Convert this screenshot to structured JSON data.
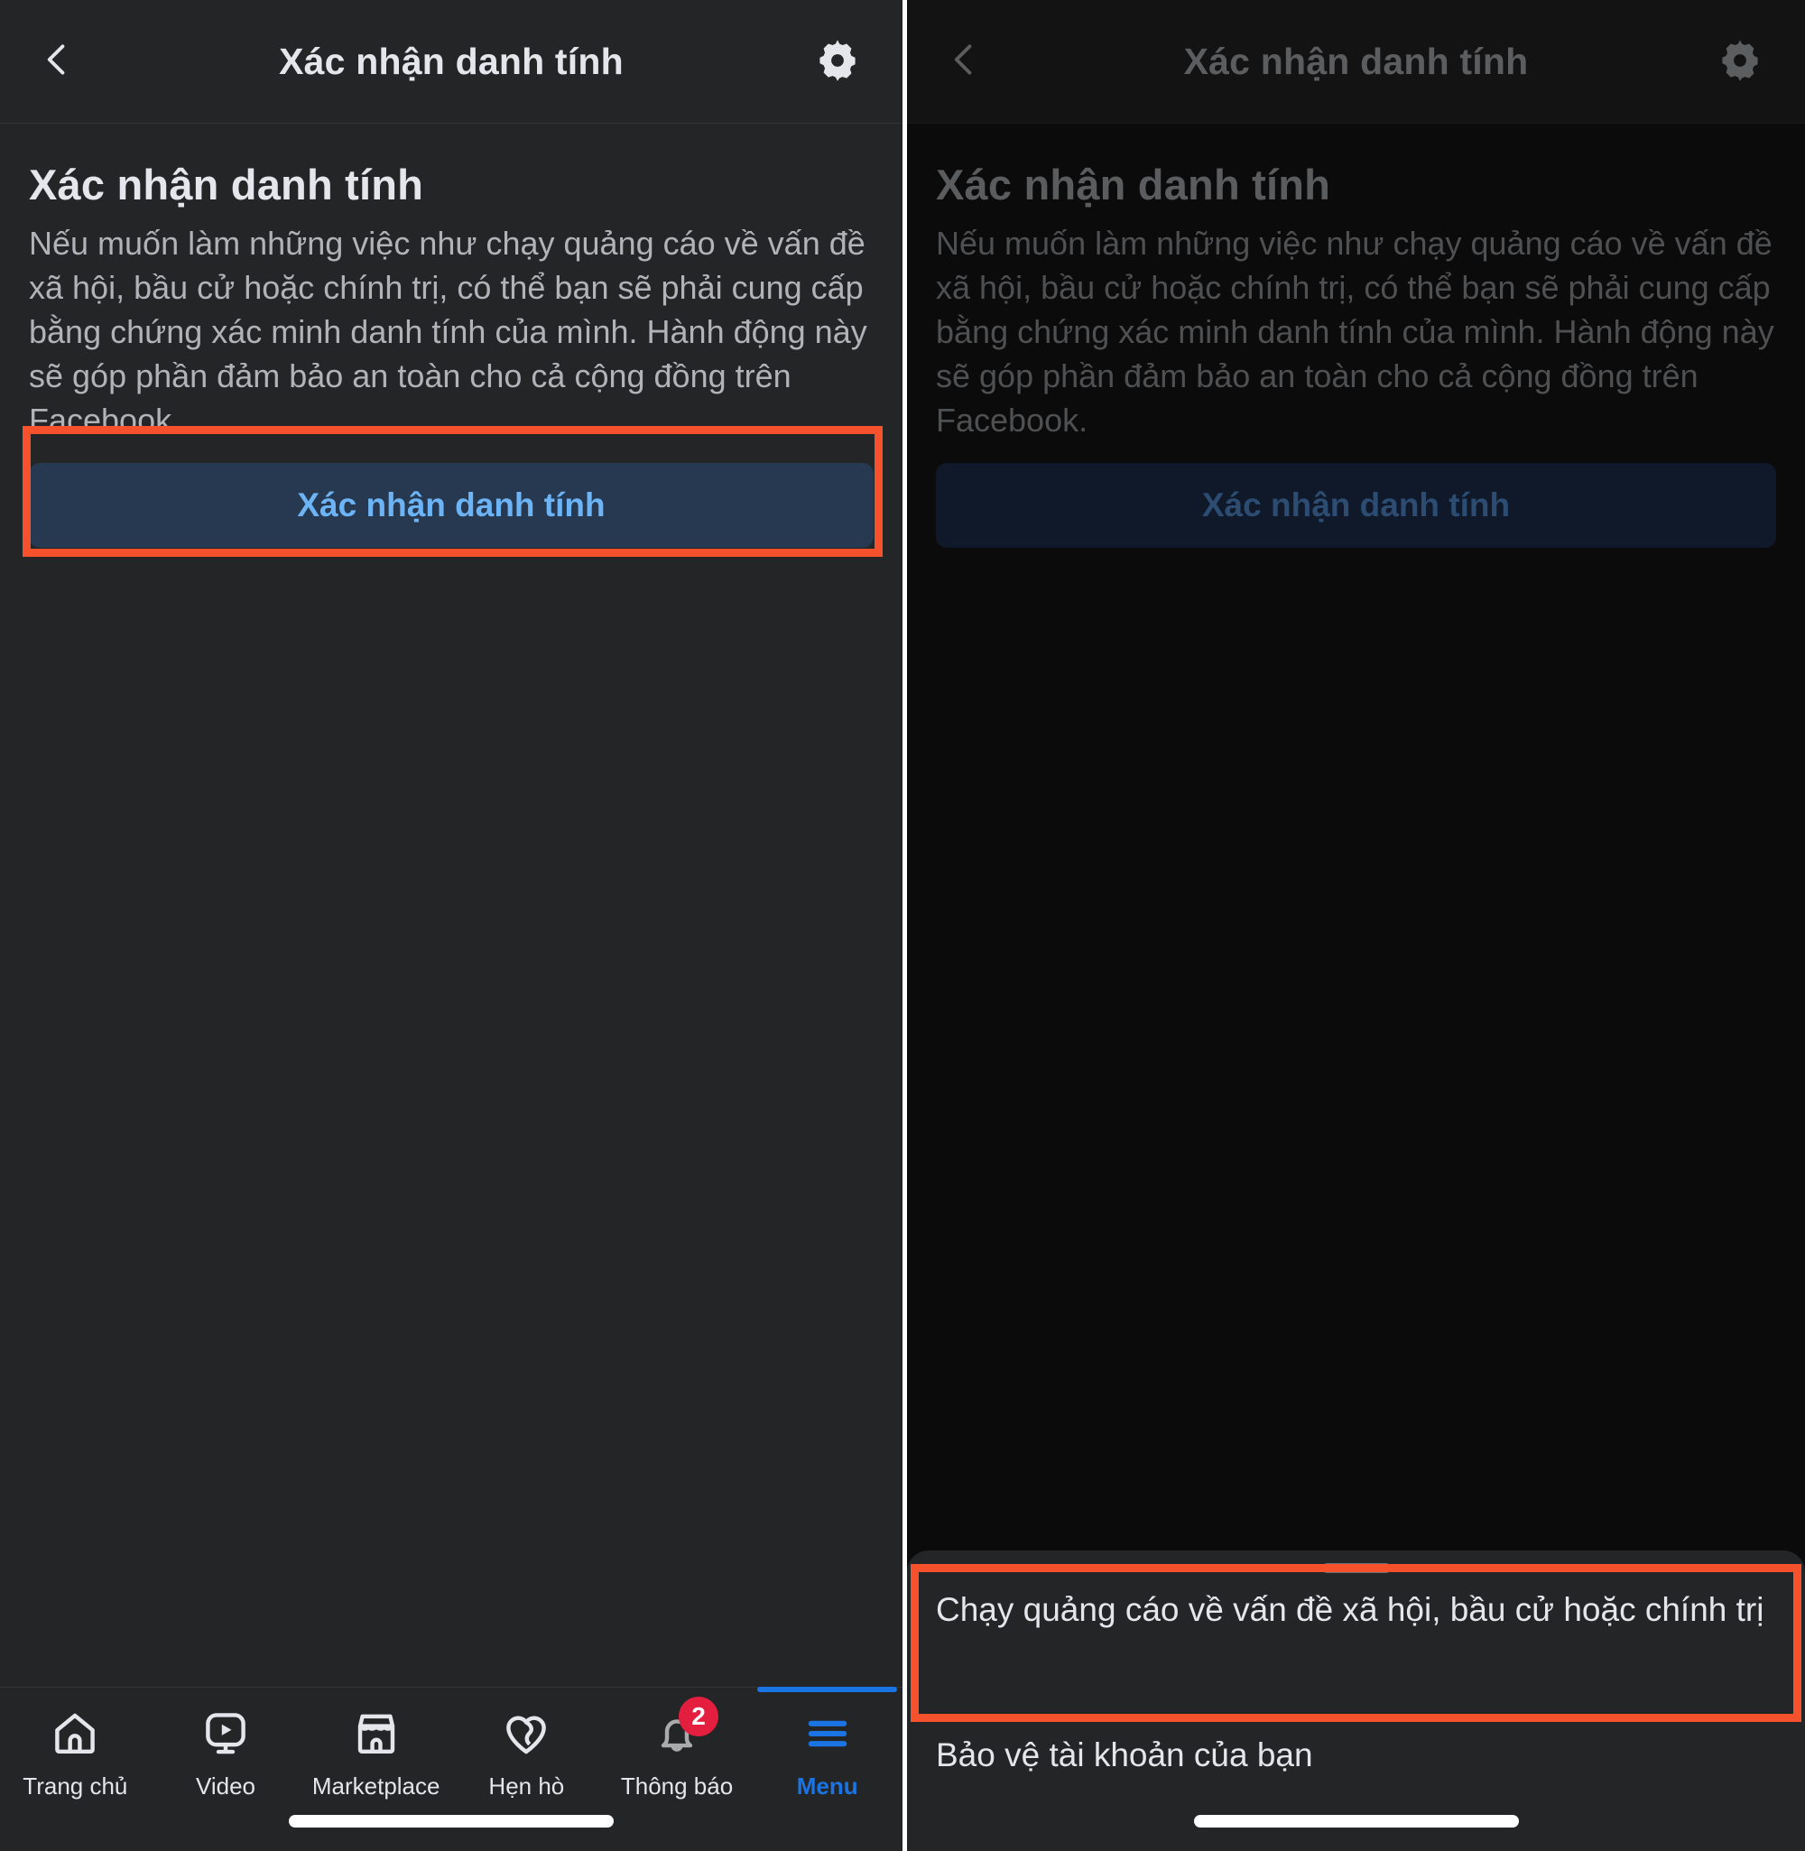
{
  "colors": {
    "highlight": "#f4512c",
    "accent_blue": "#1b74e4",
    "cta_text": "#6cb4f5",
    "cta_bg": "#263951",
    "badge_red": "#e41e3f",
    "panel_bg": "#242526",
    "dim_panel_bg": "#0b0b0c"
  },
  "header": {
    "title": "Xác nhận danh tính",
    "back_icon": "chevron-left-icon",
    "settings_icon": "gear-icon"
  },
  "main": {
    "title": "Xác nhận danh tính",
    "description": "Nếu muốn làm những việc như chạy quảng cáo về vấn đề xã hội, bầu cử hoặc chính trị, có thể bạn sẽ phải cung cấp bằng chứng xác minh danh tính của mình. Hành động này sẽ góp phần đảm bảo an toàn cho cả cộng đồng trên Facebook.",
    "cta_label": "Xác nhận danh tính"
  },
  "tabbar": {
    "items": [
      {
        "label": "Trang chủ",
        "icon": "home-icon",
        "active": false,
        "badge": ""
      },
      {
        "label": "Video",
        "icon": "video-icon",
        "active": false,
        "badge": ""
      },
      {
        "label": "Marketplace",
        "icon": "marketplace-icon",
        "active": false,
        "badge": ""
      },
      {
        "label": "Hẹn hò",
        "icon": "dating-heart-icon",
        "active": false,
        "badge": ""
      },
      {
        "label": "Thông báo",
        "icon": "bell-icon",
        "active": false,
        "badge": "2"
      },
      {
        "label": "Menu",
        "icon": "hamburger-icon",
        "active": true,
        "badge": ""
      }
    ]
  },
  "bottom_sheet": {
    "handle": "drag-handle",
    "items": [
      {
        "label": "Chạy quảng cáo về vấn đề xã hội, bầu cử hoặc chính trị"
      },
      {
        "label": "Bảo vệ tài khoản của bạn"
      }
    ]
  }
}
